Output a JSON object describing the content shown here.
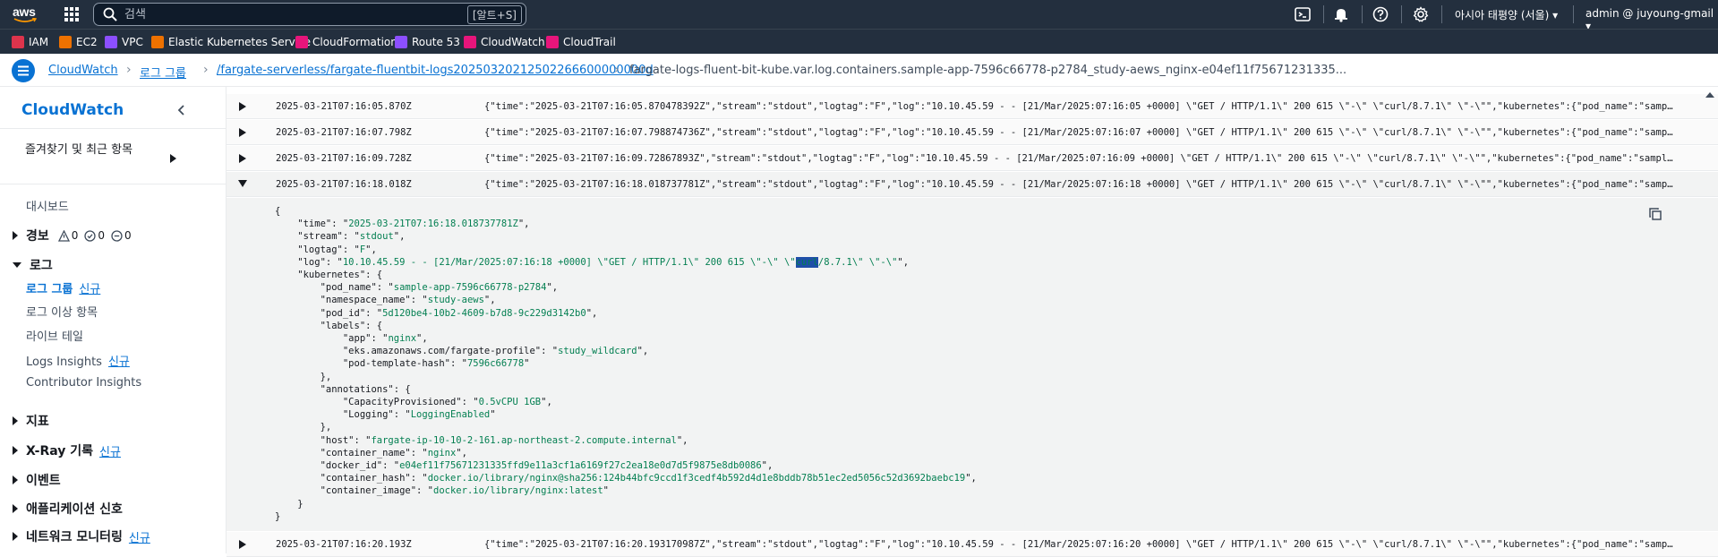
{
  "topnav": {
    "logo_text": "aws",
    "search_placeholder": "검색",
    "search_shortcut": "[알트+S]",
    "region": "아시아 태평양 (서울)",
    "account": "admin @ juyoung-gmail"
  },
  "favorites": [
    {
      "label": "IAM",
      "color": "#dd344c"
    },
    {
      "label": "EC2",
      "color": "#ed7100"
    },
    {
      "label": "VPC",
      "color": "#8c4fff"
    },
    {
      "label": "Elastic Kubernetes Service",
      "color": "#ed7100"
    },
    {
      "label": "CloudFormation",
      "color": "#e7157b"
    },
    {
      "label": "Route 53",
      "color": "#8c4fff"
    },
    {
      "label": "CloudWatch",
      "color": "#e7157b"
    },
    {
      "label": "CloudTrail",
      "color": "#e7157b"
    }
  ],
  "breadcrumb": {
    "items": [
      "CloudWatch",
      "로그 그룹",
      "/fargate-serverless/fargate-fluentbit-logs20250320212502266600000000d",
      "fargate-logs-fluent-bit-kube.var.log.containers.sample-app-7596c66778-p2784_study-aews_nginx-e04ef11f75671231335..."
    ],
    "separator": "›"
  },
  "sidebar": {
    "title": "CloudWatch",
    "favorites_label": "즐겨찾기 및 최근 항목",
    "dashboard": "대시보드",
    "alarms": {
      "label": "경보",
      "alarm_count": "0",
      "ok_count": "0",
      "insufficient_count": "0"
    },
    "logs": {
      "label": "로그",
      "items": [
        {
          "label": "로그 그룹",
          "badge": "신규"
        },
        {
          "label": "로그 이상 항목",
          "badge": ""
        },
        {
          "label": "라이브 테일",
          "badge": ""
        },
        {
          "label": "Logs Insights",
          "badge": "신규"
        },
        {
          "label": "Contributor Insights",
          "badge": ""
        }
      ]
    },
    "sections": [
      {
        "label": "지표",
        "badge": ""
      },
      {
        "label": "X-Ray 기록",
        "badge": "신규"
      },
      {
        "label": "이벤트",
        "badge": ""
      },
      {
        "label": "애플리케이션 신호",
        "badge": ""
      },
      {
        "label": "네트워크 모니터링",
        "badge": "신규"
      }
    ]
  },
  "log_events": [
    {
      "timestamp": "2025-03-21T07:16:05.870Z",
      "message": "{\"time\":\"2025-03-21T07:16:05.870478392Z\",\"stream\":\"stdout\",\"logtag\":\"F\",\"log\":\"10.10.45.59 - - [21/Mar/2025:07:16:05 +0000] \\\"GET / HTTP/1.1\\\" 200 615 \\\"-\\\" \\\"curl/8.7.1\\\" \\\"-\\\"\",\"kubernetes\":{\"pod_name\":\"sample-app-7596c6..."
    },
    {
      "timestamp": "2025-03-21T07:16:07.798Z",
      "message": "{\"time\":\"2025-03-21T07:16:07.798874736Z\",\"stream\":\"stdout\",\"logtag\":\"F\",\"log\":\"10.10.45.59 - - [21/Mar/2025:07:16:07 +0000] \\\"GET / HTTP/1.1\\\" 200 615 \\\"-\\\" \\\"curl/8.7.1\\\" \\\"-\\\"\",\"kubernetes\":{\"pod_name\":\"sample-app-7596c6..."
    },
    {
      "timestamp": "2025-03-21T07:16:09.728Z",
      "message": "{\"time\":\"2025-03-21T07:16:09.72867893Z\",\"stream\":\"stdout\",\"logtag\":\"F\",\"log\":\"10.10.45.59 - - [21/Mar/2025:07:16:09 +0000] \\\"GET / HTTP/1.1\\\" 200 615 \\\"-\\\" \\\"curl/8.7.1\\\" \\\"-\\\"\",\"kubernetes\":{\"pod_name\":\"sample-app-7596c6..."
    },
    {
      "timestamp": "2025-03-21T07:16:18.018Z",
      "message": "{\"time\":\"2025-03-21T07:16:18.018737781Z\",\"stream\":\"stdout\",\"logtag\":\"F\",\"log\":\"10.10.45.59 - - [21/Mar/2025:07:16:18 +0000] \\\"GET / HTTP/1.1\\\" 200 615 \\\"-\\\" \\\"curl/8.7.1\\\" \\\"-\\\"\",\"kubernetes\":{\"pod_name\":\"sample-app-7596c6..."
    },
    {
      "timestamp": "2025-03-21T07:16:20.193Z",
      "message": "{\"time\":\"2025-03-21T07:16:20.193170987Z\",\"stream\":\"stdout\",\"logtag\":\"F\",\"log\":\"10.10.45.59 - - [21/Mar/2025:07:16:20 +0000] \\\"GET / HTTP/1.1\\\" 200 615 \\\"-\\\" \\\"curl/8.7.1\\\" \\\"-\\\"\",\"kubernetes\":{\"pod_name\":\"sample-app-7596c6..."
    }
  ],
  "expanded_event": {
    "time": "2025-03-21T07:16:18.018737781Z",
    "stream": "stdout",
    "logtag": "F",
    "log_prefix": "10.10.45.59 - - [21/Mar/2025:07:16:18 +0000] \\\"GET / HTTP/1.1\\\" 200 615 \\\"-\\\" \\\"",
    "log_selected": "curl",
    "log_suffix": "/8.7.1\\\" \\\"-\\\"",
    "pod_name": "sample-app-7596c66778-p2784",
    "namespace_name": "study-aews",
    "pod_id": "5d120be4-10b2-4609-b7d8-9c229d3142b0",
    "label_app": "nginx",
    "label_fargate_profile": "study_wildcard",
    "label_pod_template_hash": "7596c66778",
    "annotation_capacity": "0.5vCPU 1GB",
    "annotation_logging": "LoggingEnabled",
    "host": "fargate-ip-10-10-2-161.ap-northeast-2.compute.internal",
    "container_name": "nginx",
    "docker_id": "e04ef11f75671231335ffd9e11a3cf1a6169f27c2ea18e0d7d5f9875e8db0086",
    "container_hash": "docker.io/library/nginx@sha256:124b44bfc9ccd1f3cedf4b592d4d1e8bddb78b51ec2ed5056c52d3692baebc19",
    "container_image": "docker.io/library/nginx:latest"
  }
}
